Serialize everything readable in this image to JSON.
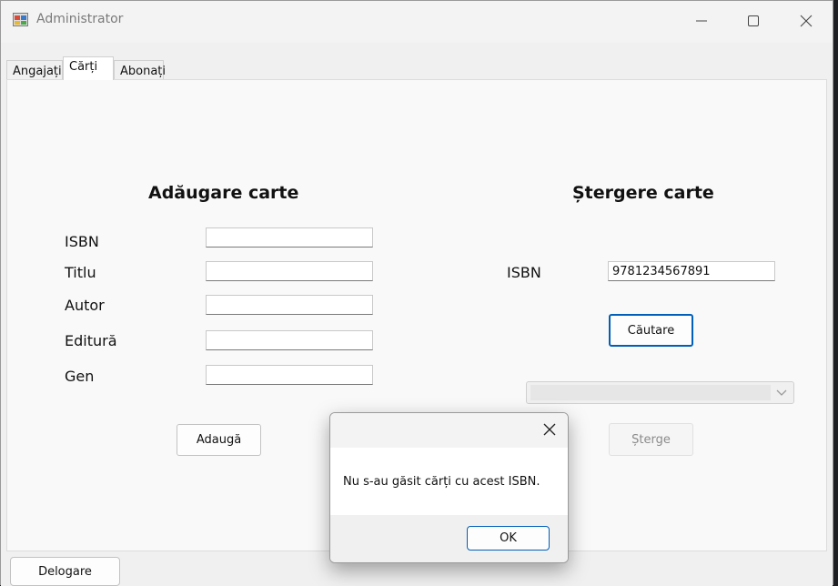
{
  "window": {
    "title": "Administrator"
  },
  "tabs": [
    {
      "label": "Angajați",
      "active": false
    },
    {
      "label": "Cărți",
      "active": true
    },
    {
      "label": "Abonați",
      "active": false
    }
  ],
  "add_section": {
    "title": "Adăugare carte",
    "fields": [
      {
        "label": "ISBN",
        "value": ""
      },
      {
        "label": "Titlu",
        "value": ""
      },
      {
        "label": "Autor",
        "value": ""
      },
      {
        "label": "Editură",
        "value": ""
      },
      {
        "label": "Gen",
        "value": ""
      }
    ],
    "submit_label": "Adaugă"
  },
  "delete_section": {
    "title": "Ștergere carte",
    "isbn_label": "ISBN",
    "isbn_value": "9781234567891",
    "search_label": "Căutare",
    "delete_label": "Șterge"
  },
  "logout_label": "Delogare",
  "dialog": {
    "message": "Nu s-au găsit cărți cu acest ISBN.",
    "ok_label": "OK"
  },
  "colors": {
    "accent": "#005fb8",
    "window_bg": "#f0f0f0",
    "panel_bg": "#f9f9f9"
  },
  "icons": {
    "app": "app-icon",
    "minimize": "minimize-icon",
    "maximize": "maximize-icon",
    "close": "close-icon",
    "dropdown": "chevron-down-icon"
  }
}
